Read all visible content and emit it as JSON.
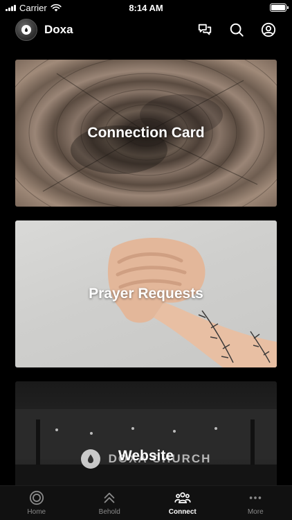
{
  "status_bar": {
    "carrier": "Carrier",
    "time": "8:14 AM",
    "battery_level": 1.0
  },
  "header": {
    "app_name": "Doxa",
    "icons": [
      "messages-icon",
      "search-icon",
      "profile-icon"
    ]
  },
  "cards": [
    {
      "label": "Connection Card",
      "image": "wood-rings"
    },
    {
      "label": "Prayer Requests",
      "image": "praying-hands"
    },
    {
      "label": "Website",
      "image": "church-interior",
      "logo_text": "DOXA CHURCH"
    }
  ],
  "tabs": [
    {
      "label": "Home",
      "icon": "home-circle-icon",
      "active": false
    },
    {
      "label": "Behold",
      "icon": "chevrons-up-icon",
      "active": false
    },
    {
      "label": "Connect",
      "icon": "people-icon",
      "active": true
    },
    {
      "label": "More",
      "icon": "ellipsis-icon",
      "active": false
    }
  ],
  "colors": {
    "background": "#000000",
    "tab_bar": "#111111",
    "tab_inactive": "#8a8a8a",
    "tab_active": "#ffffff"
  }
}
